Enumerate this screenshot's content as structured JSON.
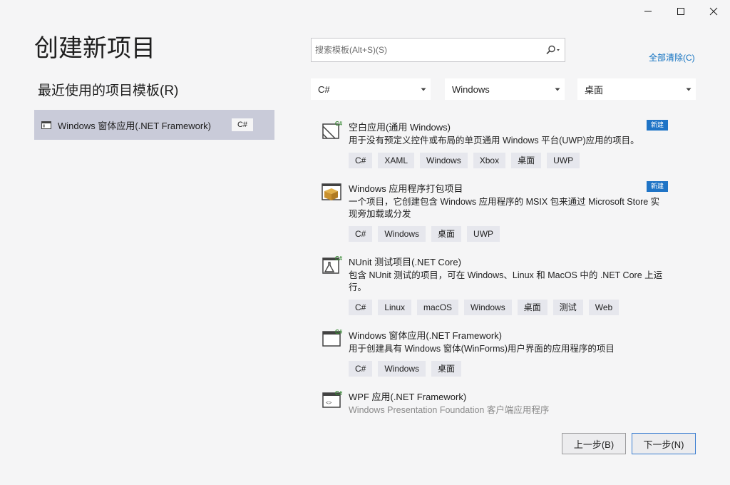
{
  "window": {
    "minimize_icon": "minimize-icon",
    "maximize_icon": "maximize-icon",
    "close_icon": "close-icon"
  },
  "page": {
    "title": "创建新项目",
    "recent_heading": "最近使用的项目模板(R)"
  },
  "recent": [
    {
      "label": "Windows 窗体应用(.NET Framework)",
      "lang": "C#",
      "icon": "winforms-icon"
    }
  ],
  "search": {
    "placeholder": "搜索模板(Alt+S)(S)",
    "value": "",
    "icon": "search-icon"
  },
  "clear_all": "全部清除(C)",
  "filters": {
    "language": "C#",
    "platform": "Windows",
    "project_type": "桌面"
  },
  "templates": [
    {
      "title": "空白应用(通用 Windows)",
      "desc": "用于没有预定义控件或布局的单页通用 Windows 平台(UWP)应用的项目。",
      "badge": "新建",
      "icon": "uwp-blank-app-icon",
      "tags": [
        "C#",
        "XAML",
        "Windows",
        "Xbox",
        "桌面",
        "UWP"
      ]
    },
    {
      "title": "Windows 应用程序打包项目",
      "desc": "一个项目，它创建包含 Windows 应用程序的 MSIX 包来通过 Microsoft Store 实现旁加载或分发",
      "badge": "新建",
      "icon": "packaging-project-icon",
      "tags": [
        "C#",
        "Windows",
        "桌面",
        "UWP"
      ]
    },
    {
      "title": "NUnit 测试项目(.NET Core)",
      "desc": "包含 NUnit 测试的项目，可在 Windows、Linux 和 MacOS 中的 .NET Core 上运行。",
      "badge": "",
      "icon": "nunit-test-icon",
      "tags": [
        "C#",
        "Linux",
        "macOS",
        "Windows",
        "桌面",
        "测试",
        "Web"
      ]
    },
    {
      "title": "Windows 窗体应用(.NET Framework)",
      "desc": "用于创建具有 Windows 窗体(WinForms)用户界面的应用程序的项目",
      "badge": "",
      "icon": "winforms-app-icon",
      "tags": [
        "C#",
        "Windows",
        "桌面"
      ]
    },
    {
      "title": "WPF 应用(.NET Framework)",
      "desc": "Windows Presentation Foundation 客户端应用程序",
      "badge": "",
      "icon": "wpf-app-icon",
      "tags": []
    }
  ],
  "buttons": {
    "back": "上一步(B)",
    "next": "下一步(N)"
  }
}
